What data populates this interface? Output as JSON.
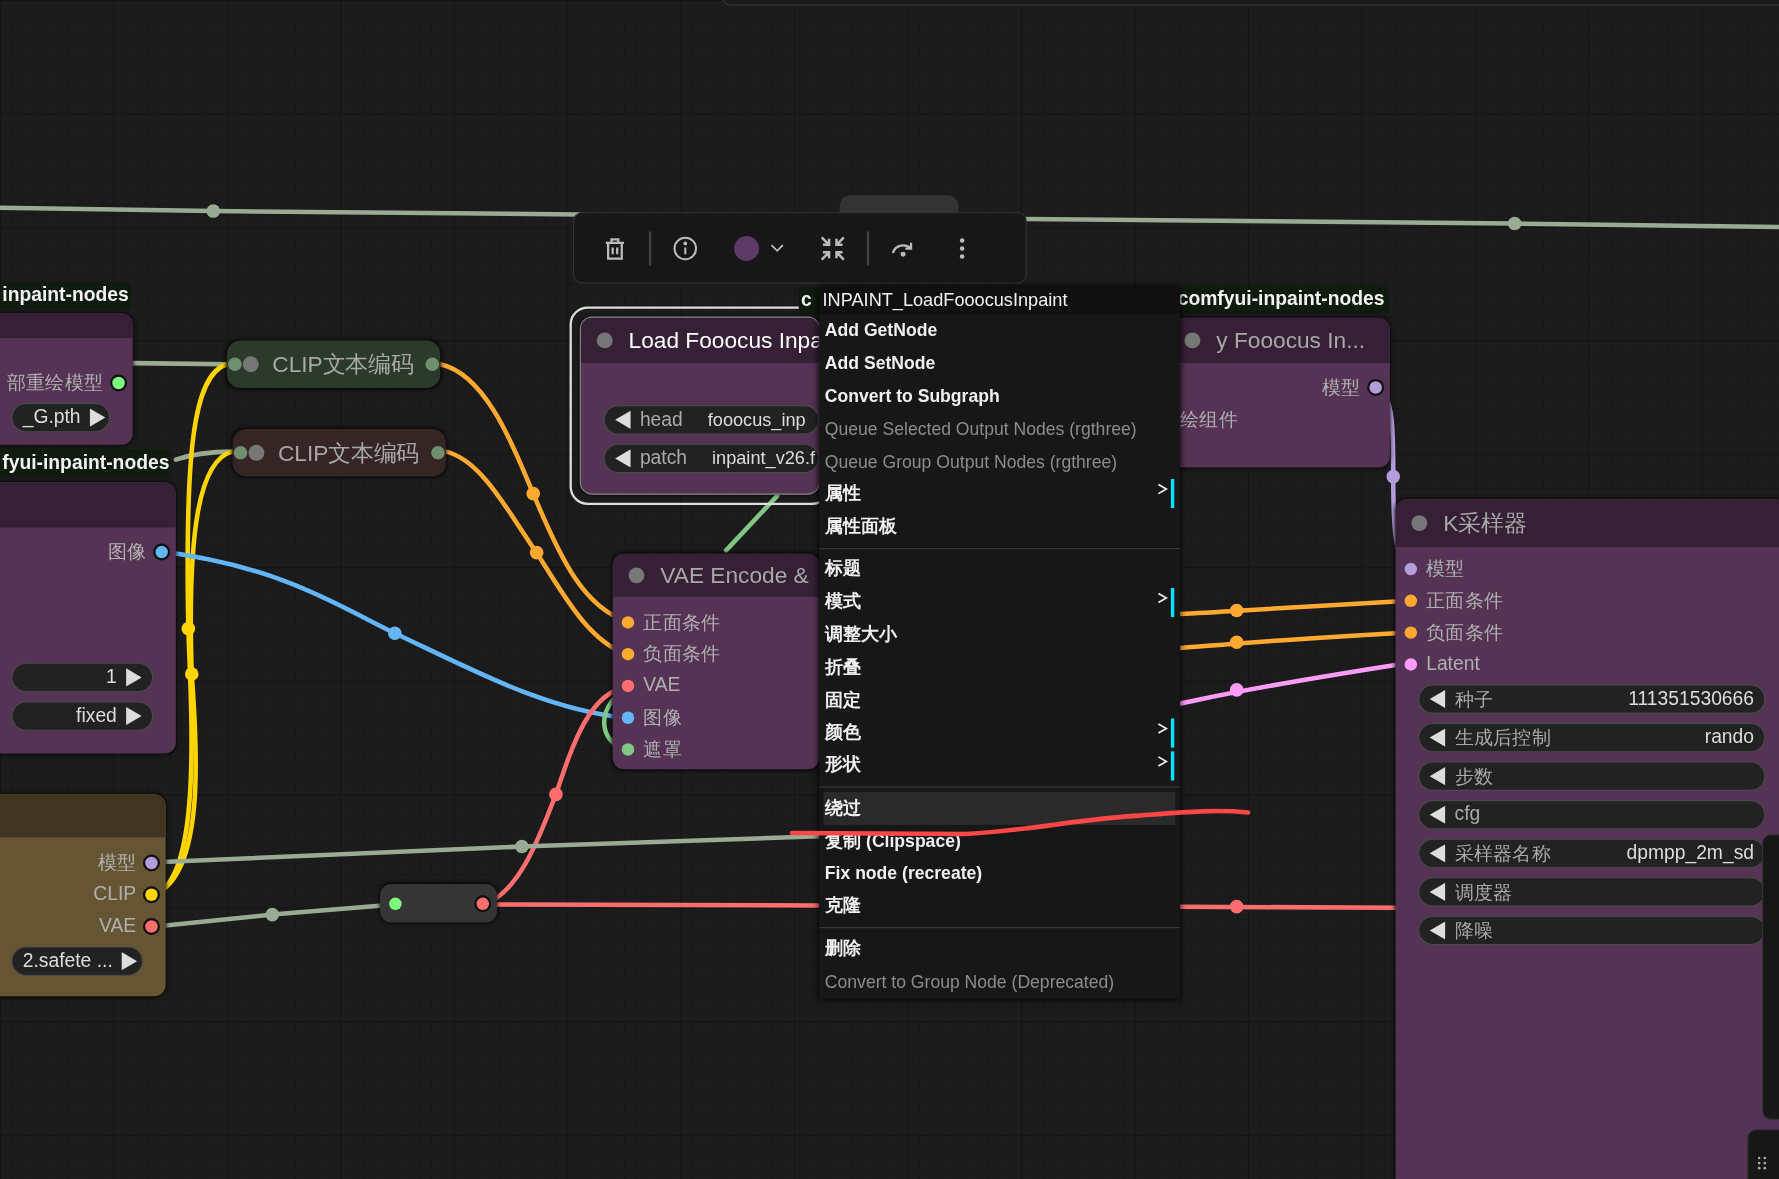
{
  "toolbar": {
    "color": "#5b3b66"
  },
  "nodes": [
    {
      "kind": "node",
      "tag": "inpaint-nodes",
      "color": "#553355",
      "selected": false,
      "rows": [
        {
          "kind": "output",
          "label": "部重绘模型",
          "color": "#7dfa7d"
        },
        {
          "kind": "widget",
          "value": "_G.pth"
        }
      ]
    },
    {
      "kind": "node",
      "tag": "fyui-inpaint-nodes",
      "color": "#553355",
      "selected": false,
      "rows": [
        {
          "kind": "output",
          "label": "图像",
          "color": "#64b5f6"
        },
        {
          "kind": "widget",
          "value": "1"
        },
        {
          "kind": "widget",
          "value": "fixed"
        }
      ]
    },
    {
      "kind": "node",
      "color": "#665533",
      "selected": false,
      "rows": [
        {
          "kind": "output",
          "label": "模型",
          "color": "#b39ddb"
        },
        {
          "kind": "output",
          "label": "CLIP",
          "color": "#ffd500"
        },
        {
          "kind": "output",
          "label": "VAE",
          "color": "#ff6e6e"
        },
        {
          "kind": "widget",
          "value": "2.safete ..."
        }
      ]
    },
    {
      "kind": "collapsed",
      "title": "CLIP文本编码",
      "color": "#2b3a2b",
      "selected": false
    },
    {
      "kind": "collapsed",
      "title": "CLIP文本编码",
      "color": "#352525",
      "selected": false
    },
    {
      "kind": "node",
      "tag": "c",
      "title": "Load Fooocus Inpa",
      "color": "#553355",
      "selected": true,
      "rows": [
        {
          "kind": "widget",
          "label": "head",
          "value": "fooocus_inp"
        },
        {
          "kind": "widget",
          "label": "patch",
          "value": "inpaint_v26.f"
        }
      ]
    },
    {
      "kind": "node",
      "tag": "comfyui-inpaint-nodes",
      "title": "y Fooocus In...",
      "color": "#553355",
      "selected": false,
      "rows": [
        {
          "kind": "output",
          "label": "模型",
          "color": "#b39ddb"
        },
        {
          "kind": "text",
          "label": "绘组件"
        }
      ]
    },
    {
      "kind": "node",
      "title": "VAE Encode &",
      "color": "#553355",
      "selected": false,
      "rows": [
        {
          "kind": "input",
          "label": "正面条件",
          "color": "#ffa931"
        },
        {
          "kind": "input",
          "label": "负面条件",
          "color": "#ffa931"
        },
        {
          "kind": "input",
          "label": "VAE",
          "color": "#ff6e6e"
        },
        {
          "kind": "input",
          "label": "图像",
          "color": "#64b5f6"
        },
        {
          "kind": "input",
          "label": "遮罩",
          "color": "#81c784"
        }
      ]
    },
    {
      "kind": "reroute",
      "color": "#353535",
      "selected": false,
      "rows": [
        {
          "kind": "input",
          "color": "#7dfa7d"
        },
        {
          "kind": "output",
          "color": "#ff6e6e"
        }
      ]
    },
    {
      "kind": "node",
      "title": "K采样器",
      "color": "#553355",
      "selected": false,
      "rows": [
        {
          "kind": "input",
          "label": "模型",
          "color": "#b39ddb"
        },
        {
          "kind": "input",
          "label": "正面条件",
          "color": "#ffa931"
        },
        {
          "kind": "input",
          "label": "负面条件",
          "color": "#ffa931"
        },
        {
          "kind": "input",
          "label": "Latent",
          "color": "#ff9cf9"
        },
        {
          "kind": "widget",
          "label": "种子",
          "value": "111351530666"
        },
        {
          "kind": "widget",
          "label": "生成后控制",
          "value": "rando"
        },
        {
          "kind": "widget",
          "label": "步数"
        },
        {
          "kind": "widget",
          "label": "cfg"
        },
        {
          "kind": "widget",
          "label": "采样器名称",
          "value": "dpmpp_2m_sd"
        },
        {
          "kind": "widget",
          "label": "调度器"
        },
        {
          "kind": "widget",
          "label": "降噪"
        }
      ]
    }
  ],
  "context_menu": {
    "title": "INPAINT_LoadFooocusInpaint",
    "groups": [
      [
        {
          "kind": "action",
          "label": "Add GetNode",
          "disabled": false,
          "selected": false
        },
        {
          "kind": "action",
          "label": "Add SetNode",
          "disabled": false,
          "selected": false
        },
        {
          "kind": "action",
          "label": "Convert to Subgraph",
          "disabled": false,
          "selected": false
        },
        {
          "kind": "action",
          "label": "Queue Selected Output Nodes (rgthree)",
          "disabled": true,
          "selected": false
        },
        {
          "kind": "action",
          "label": "Queue Group Output Nodes (rgthree)",
          "disabled": true,
          "selected": false
        },
        {
          "kind": "submenu",
          "label": "属性",
          "disabled": false,
          "selected": false
        },
        {
          "kind": "action",
          "label": "属性面板",
          "disabled": false,
          "selected": false
        }
      ],
      [
        {
          "kind": "action",
          "label": "标题",
          "disabled": false,
          "selected": false
        },
        {
          "kind": "submenu",
          "label": "模式",
          "disabled": false,
          "selected": false
        },
        {
          "kind": "action",
          "label": "调整大小",
          "disabled": false,
          "selected": false
        },
        {
          "kind": "action",
          "label": "折叠",
          "disabled": false,
          "selected": false
        },
        {
          "kind": "action",
          "label": "固定",
          "disabled": false,
          "selected": false
        },
        {
          "kind": "submenu",
          "label": "颜色",
          "disabled": false,
          "selected": false
        },
        {
          "kind": "submenu",
          "label": "形状",
          "disabled": false,
          "selected": false
        }
      ],
      [
        {
          "kind": "action",
          "label": "绕过",
          "disabled": false,
          "selected": true
        },
        {
          "kind": "action",
          "label": "复制 (Clipspace)",
          "disabled": false,
          "selected": false
        },
        {
          "kind": "action",
          "label": "Fix node (recreate)",
          "disabled": false,
          "selected": false
        },
        {
          "kind": "action",
          "label": "克隆",
          "disabled": false,
          "selected": false
        }
      ],
      [
        {
          "kind": "action",
          "label": "删除",
          "disabled": false,
          "selected": false
        },
        {
          "kind": "action",
          "label": "Convert to Group Node (Deprecated)",
          "disabled": true,
          "selected": false
        }
      ]
    ]
  }
}
